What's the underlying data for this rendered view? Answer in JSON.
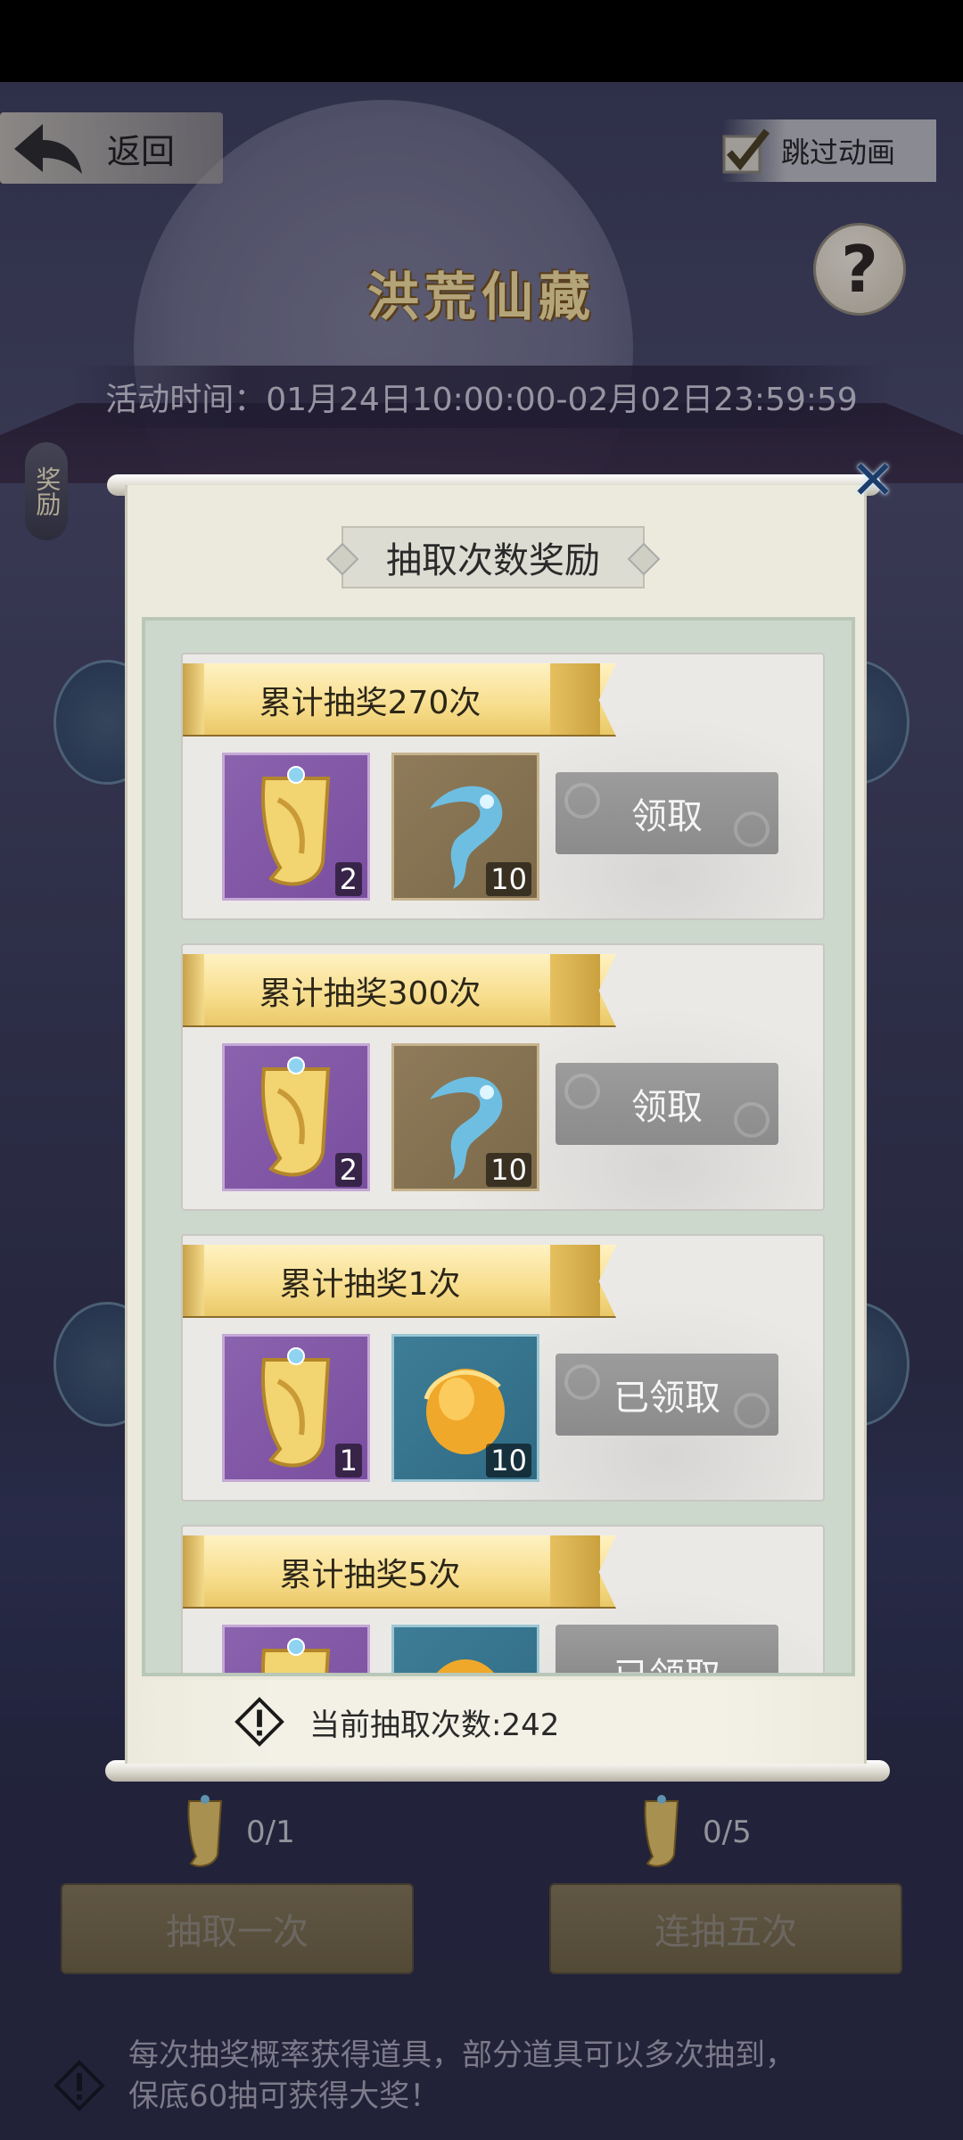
{
  "header": {
    "back_label": "返回",
    "skip_label": "跳过动画",
    "help_glyph": "?",
    "title": "洪荒仙藏",
    "time_label": "活动时间：",
    "time_value": "01月24日10:00:00-02月02日23:59:59",
    "reward_tag": "奖励"
  },
  "modal": {
    "title": "抽取次数奖励",
    "close_glyph": "✕",
    "current_count_text": "当前抽取次数:242",
    "rewards": [
      {
        "label": "累计抽奖270次",
        "items": [
          {
            "icon": "golden-scroll-icon",
            "count": "2",
            "tone": "purple"
          },
          {
            "icon": "blue-spirit-flame-icon",
            "count": "10",
            "tone": "bronze"
          }
        ],
        "button": "领取"
      },
      {
        "label": "累计抽奖300次",
        "items": [
          {
            "icon": "golden-scroll-icon",
            "count": "2",
            "tone": "purple"
          },
          {
            "icon": "blue-spirit-flame-icon",
            "count": "10",
            "tone": "bronze"
          }
        ],
        "button": "领取"
      },
      {
        "label": "累计抽奖1次",
        "items": [
          {
            "icon": "golden-scroll-icon",
            "count": "1",
            "tone": "purple"
          },
          {
            "icon": "gold-orb-icon",
            "count": "10",
            "tone": "teal"
          }
        ],
        "button": "已领取"
      },
      {
        "label": "累计抽奖5次",
        "items": [
          {
            "icon": "golden-scroll-icon",
            "count": "",
            "tone": "purple"
          },
          {
            "icon": "gold-orb-icon",
            "count": "",
            "tone": "teal"
          }
        ],
        "button": "已领取"
      }
    ]
  },
  "footer": {
    "left_count": "0/1",
    "right_count": "0/5",
    "draw_once": "抽取一次",
    "draw_five": "连抽五次",
    "tip_line1": "每次抽奖概率获得道具，部分道具可以多次抽到，",
    "tip_line2": "保底60抽可获得大奖！"
  },
  "colors": {
    "banner_gold": "#f7dd8c",
    "claim_gray": "#8f8f8f",
    "draw_button_gold": "#b89d4e"
  }
}
